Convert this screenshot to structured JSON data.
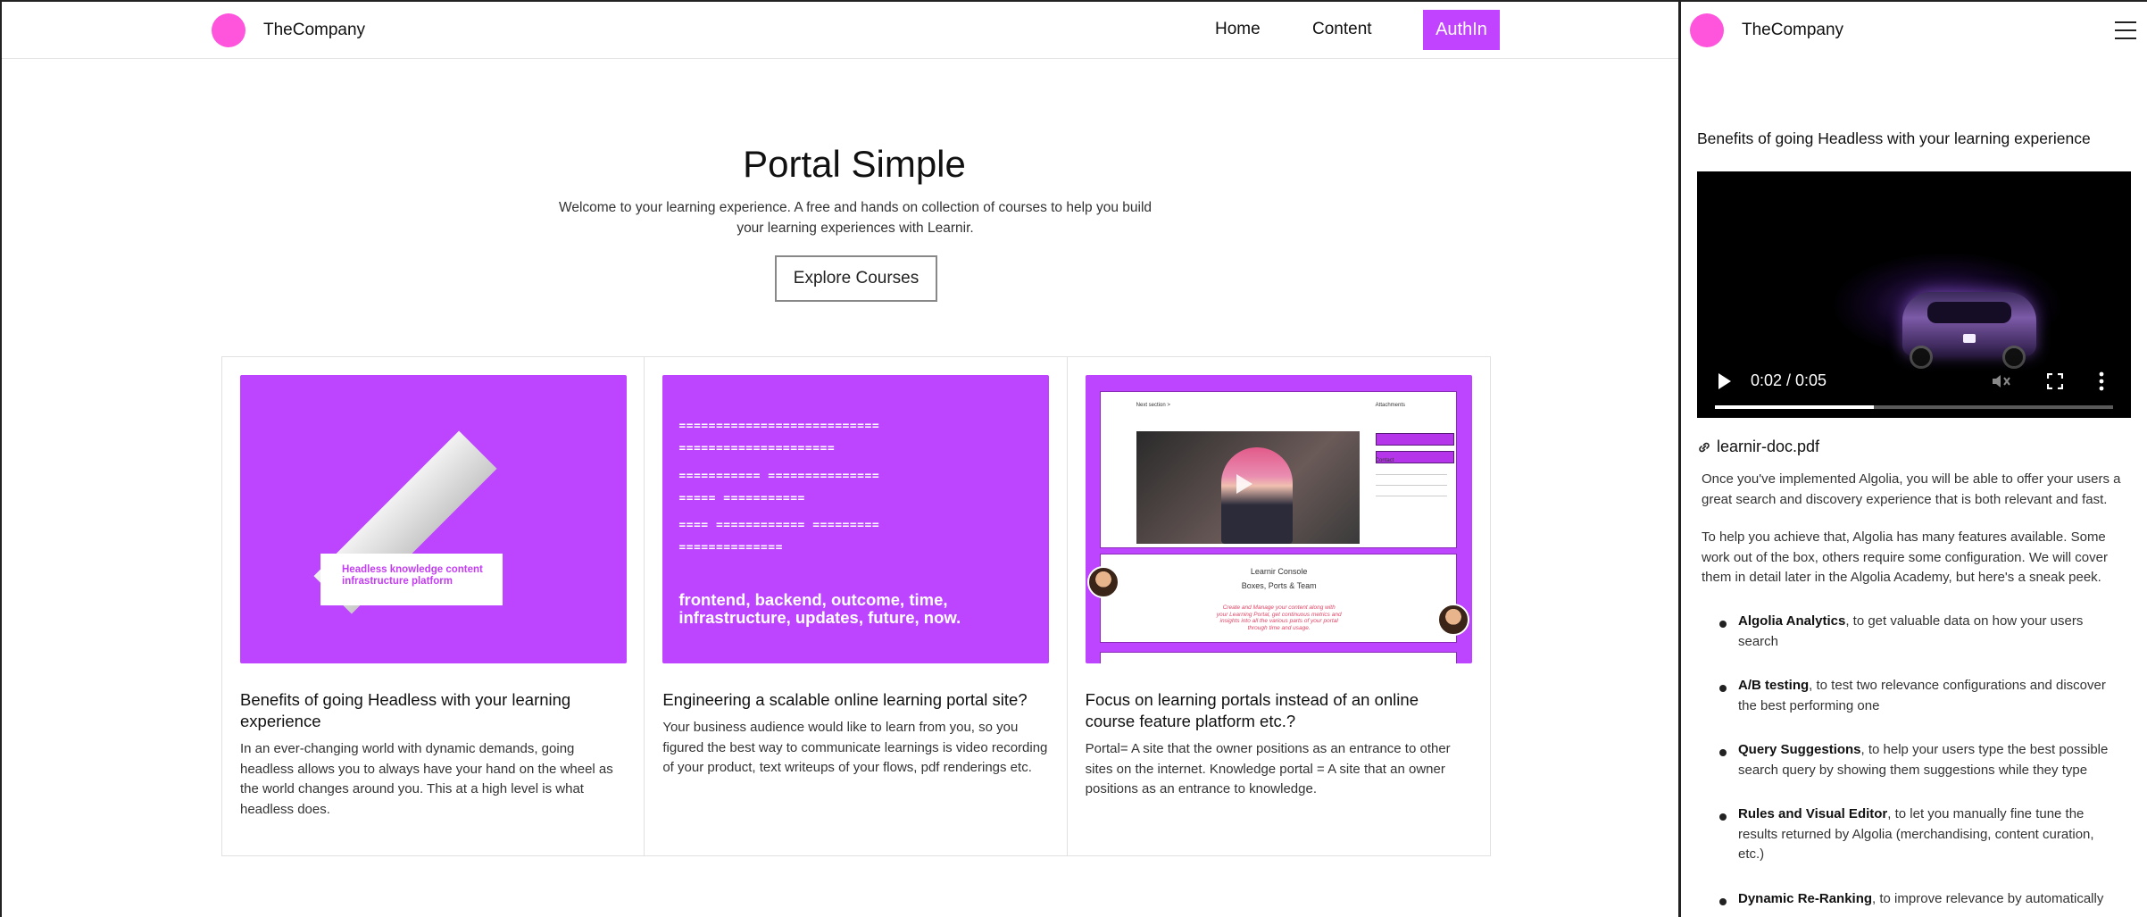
{
  "brand": {
    "name": "TheCompany",
    "logo_color": "#ff55dd"
  },
  "nav": {
    "home": "Home",
    "content": "Content",
    "auth": "AuthIn",
    "accent": "#c143ff"
  },
  "hero": {
    "title": "Portal Simple",
    "subtitle": "Welcome to your learning experience. A free and hands on collection of courses to help you build your learning experiences with Learnir.",
    "cta": "Explore Courses"
  },
  "cards": [
    {
      "title": "Benefits of going Headless with your learning experience",
      "description": "In an ever-changing world with dynamic demands, going headless allows you to always have your hand on the wheel as the world changes around you. This at a high level is what headless does.",
      "image_caption": "Headless knowledge content infrastructure platform"
    },
    {
      "title": "Engineering a scalable online learning portal site?",
      "description": "Your business audience would like to learn from you, so you figured the best way to communicate learnings is video recording of your product, text writeups of your flows, pdf renderings etc.",
      "image_lines": [
        "===========================",
        "=====================",
        "=========== ===============",
        "===== ===========",
        "==== ============ =========",
        "=============="
      ],
      "image_words": "frontend, backend, outcome, time, infrastructure, updates, future, now."
    },
    {
      "title": "Focus on learning portals instead of an online course feature platform etc.?",
      "description": "Portal= A site that the owner positions as an entrance to other sites on the internet. Knowledge portal = A site that an owner positions as an entrance to knowledge.",
      "image": {
        "next_section": "Next section >",
        "attachments": "Attachments",
        "contact": "Contact",
        "console": "Learnir Console",
        "boxes": "Boxes, Ports & Team",
        "italic": "Create and Manage your content along with your Learning Portal, get continuous metrics and insights into all the various parts of your portal through time and usage."
      }
    }
  ],
  "side": {
    "brand": "TheCompany",
    "title": "Benefits of going Headless with your learning experience",
    "video": {
      "time": "0:02 / 0:05",
      "progress": 0.4
    },
    "attachment": "learnir-doc.pdf",
    "paragraphs": [
      "Once you've implemented Algolia, you will be able to offer your users a great search and discovery experience that is both relevant and fast.",
      "To help you achieve that, Algolia has many features available. Some work out of the box, others require some configuration. We will cover them in detail later in the Algolia Academy, but here's a sneak peek."
    ],
    "features": [
      {
        "name": "Algolia Analytics",
        "text": ", to get valuable data on how your users search"
      },
      {
        "name": "A/B testing",
        "text": ", to test two relevance configurations and discover the best performing one"
      },
      {
        "name": "Query Suggestions",
        "text": ", to help your users type the best possible search query by showing them suggestions while they type"
      },
      {
        "name": "Rules and Visual Editor",
        "text": ", to let you manually fine tune the results returned by Algolia (merchandising, content curation, etc.)"
      },
      {
        "name": "Dynamic Re-Ranking",
        "text": ", to improve relevance by automatically"
      }
    ]
  }
}
